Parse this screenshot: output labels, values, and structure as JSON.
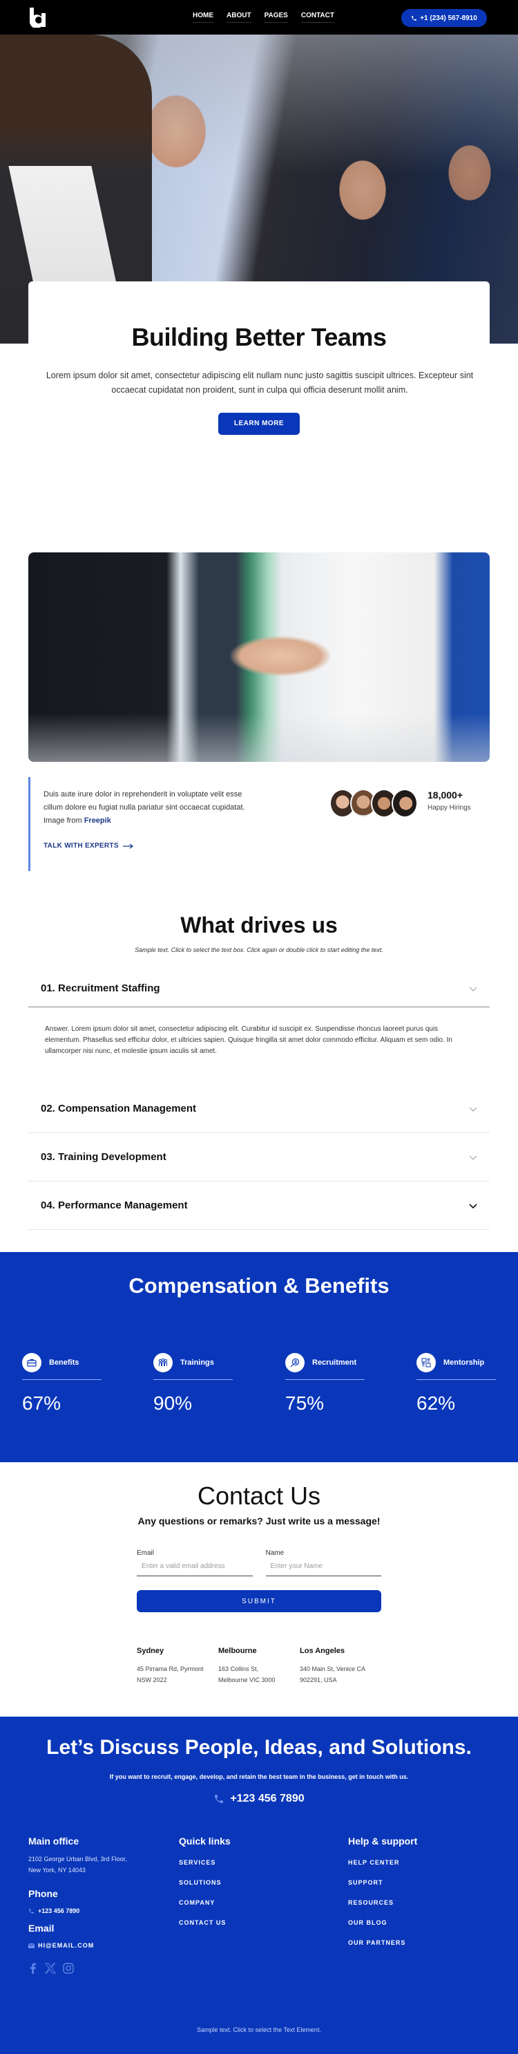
{
  "header": {
    "logo": "brand-logo",
    "nav": [
      "HOME",
      "ABOUT",
      "PAGES",
      "CONTACT"
    ],
    "phone": "+1 (234) 567-8910"
  },
  "hero": {
    "title": "Building Better Teams",
    "text": "Lorem ipsum dolor sit amet, consectetur adipiscing elit nullam nunc justo sagittis suscipit ultrices. Excepteur sint occaecat cupidatat non proident, sunt in culpa qui officia deserunt mollit anim.",
    "button": "LEARN MORE"
  },
  "team": {
    "text": "Duis aute irure dolor in reprehenderit in voluptate velit esse cillum dolore eu fugiat nulla pariatur sint occaecat cupidatat. Image from ",
    "link": "Freepik",
    "cta": "TALK WITH EXPERTS",
    "hirings_count": "18,000+",
    "hirings_label": "Happy Hirings"
  },
  "drives": {
    "title": "What drives us",
    "subtitle": "Sample text. Click to select the text box. Click again or double click to start editing the text.",
    "items": [
      {
        "title": "01. Recruitment Staffing",
        "body": "Answer. Lorem ipsum dolor sit amet, consectetur adipiscing elit. Curabitur id suscipit ex. Suspendisse rhoncus laoreet purus quis elementum. Phasellus sed efficitur dolor, et ultricies sapien. Quisque fringilla sit amet dolor commodo efficitur. Aliquam et sem odio. In ullamcorper nisi nunc, et molestie ipsum iaculis sit amet."
      },
      {
        "title": "02. Compensation Management"
      },
      {
        "title": "03. Training Development"
      },
      {
        "title": "04. Performance Management"
      }
    ]
  },
  "compensation": {
    "title": "Compensation & Benefits",
    "stats": [
      {
        "label": "Benefits",
        "value": "67%",
        "icon": "briefcase-icon"
      },
      {
        "label": "Trainings",
        "value": "90%",
        "icon": "people-group-icon"
      },
      {
        "label": "Recruitment",
        "value": "75%",
        "icon": "search-person-icon"
      },
      {
        "label": "Mentorship",
        "value": "62%",
        "icon": "mentorship-icon"
      }
    ]
  },
  "contact": {
    "title": "Contact Us",
    "subtitle": "Any questions or remarks? Just write us a message!",
    "email_label": "Email",
    "email_placeholder": "Enter a valid email address",
    "name_label": "Name",
    "name_placeholder": "Enter your Name",
    "submit": "SUBMIT",
    "offices": [
      {
        "city": "Sydney",
        "line1": "45 Pirrama Rd, Pyrmont",
        "line2": "NSW 2022"
      },
      {
        "city": "Melbourne",
        "line1": "163 Collins St,",
        "line2": "Melbourne VIC 3000"
      },
      {
        "city": "Los Angeles",
        "line1": "340 Main St, Venice CA",
        "line2": "902291, USA"
      }
    ]
  },
  "footer": {
    "cta_title": "Let’s Discuss People, Ideas, and Solutions.",
    "cta_text": "If you want to recruit, engage, develop, and retain the best team in the business, get in touch with us.",
    "cta_phone": "+123 456 7890",
    "main_office_title": "Main office",
    "address1": "2102 George Urban Blvd, 3rd Floor,",
    "address2": "New York, NY 14043",
    "phone_title": "Phone",
    "phone": "+123 456 7890",
    "email_title": "Email",
    "email": "HI@EMAIL.COM",
    "quick_links_title": "Quick links",
    "quick_links": [
      "SERVICES",
      "SOLUTIONS",
      "COMPANY",
      "CONTACT US"
    ],
    "help_title": "Help & support",
    "help_links": [
      "HELP CENTER",
      "SUPPORT",
      "RESOURCES",
      "OUR BLOG",
      "OUR PARTNERS"
    ],
    "note": "Sample text. Click to select the Text Element."
  },
  "colors": {
    "brand_blue": "#0a37b9",
    "accent_light_blue": "#5d85e6",
    "link_dark_blue": "#1d3a8a"
  }
}
